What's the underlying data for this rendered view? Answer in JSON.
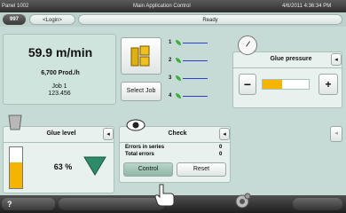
{
  "topbar": {
    "panel_name": "Panel 1002",
    "app_title": "Main Application Control",
    "datetime": "4/6/2011 4:36:34 PM"
  },
  "statusbar": {
    "code": "997",
    "user": "<Login>",
    "state": "Ready"
  },
  "speed": {
    "value": "59.9 m/min",
    "production": "6,700 Prod./h",
    "job_label": "Job 1",
    "job_number": "123.456",
    "select_job_label": "Select Job"
  },
  "lines": [
    {
      "label": "1"
    },
    {
      "label": "2"
    },
    {
      "label": "3"
    },
    {
      "label": "4"
    }
  ],
  "glue_pressure": {
    "title": "Glue pressure",
    "minus": "−",
    "plus": "+",
    "level": 0.42,
    "fill_color": "#f5b400"
  },
  "glue_level": {
    "title": "Glue level",
    "value": "63 %",
    "level": 0.63
  },
  "check": {
    "title": "Check",
    "rows": [
      {
        "label": "Errors in series",
        "value": "0"
      },
      {
        "label": "Total errors",
        "value": "0"
      }
    ],
    "control_label": "Control",
    "reset_label": "Reset"
  },
  "bottom": {
    "help": "?"
  },
  "colors": {
    "accent_blue": "#2a3fd0",
    "accent_green": "#3cae3a",
    "accent_yellow": "#f5b400"
  }
}
